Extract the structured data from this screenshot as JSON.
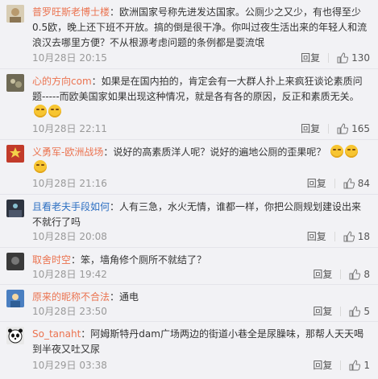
{
  "comments": [
    {
      "name": "普罗旺斯老博士楼",
      "text": "：欧洲国家号称先进发达国家。公厕少之又少，有也得至少0.5欧，晚上还下班不开放。搞的倒是很干净。你叫过夜生活出来的年轻人和流浪汉去哪里方便？不从根源考虑问题的条例都是耍流氓",
      "emoticons": 0,
      "time": "10月28日 20:15",
      "reply": "回复",
      "likes": "130",
      "avatar_color": "#c8b89a"
    },
    {
      "name": "心的方向com",
      "text": "：如果是在国内拍的，肯定会有一大群人扑上来疯狂谈论素质问题-----而欧美国家如果出现这种情况，就是各有各的原因，反正和素质无关。",
      "emoticons": 2,
      "time": "10月28日 22:11",
      "reply": "回复",
      "likes": "165",
      "avatar_color": "#6f6a55"
    },
    {
      "name": "义勇军-欧洲战场",
      "text": "：说好的高素质洋人呢？说好的遍地公厕的歪果呢？",
      "emoticons": 3,
      "time": "10月28日 21:16",
      "reply": "回复",
      "likes": "84",
      "avatar_color": "#c23b2a"
    },
    {
      "name": "且看老夫手段如何",
      "text": "：人有三急，水火无情，谁都一样，你把公厕规划建设出来不就行了吗",
      "emoticons": 0,
      "time": "10月28日 20:08",
      "reply": "回复",
      "likes": "18",
      "avatar_color": "#2e3440"
    },
    {
      "name": "取舍时空",
      "text": "：笨，墙角修个厕所不就结了？",
      "emoticons": 0,
      "time": "10月28日 19:42",
      "reply": "回复",
      "likes": "8",
      "avatar_color": "#3a3a3a"
    },
    {
      "name": "原来的昵称不合法",
      "text": "：通电",
      "emoticons": 0,
      "time": "10月28日 23:50",
      "reply": "回复",
      "likes": "5",
      "avatar_color": "#4a7fc1"
    },
    {
      "name": "So_tanaht",
      "text": "：阿姆斯特丹dam广场两边的街道小巷全是尿臊味，那帮人天天喝到半夜又吐又尿",
      "emoticons": 0,
      "time": "10月29日 03:38",
      "reply": "回复",
      "likes": "1",
      "avatar_color": "#1e1e1e"
    }
  ]
}
